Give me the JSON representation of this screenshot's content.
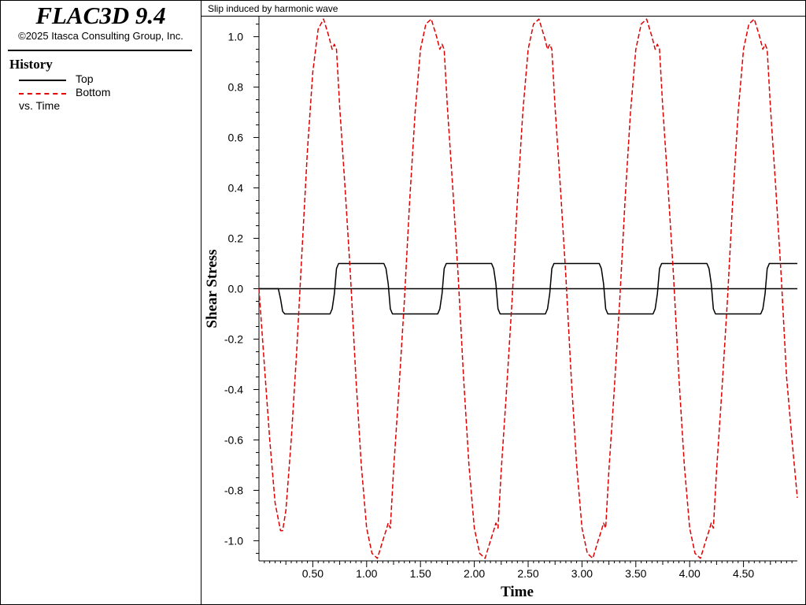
{
  "app": {
    "title": "FLAC3D 9.4",
    "copyright": "©2025 Itasca Consulting Group, Inc."
  },
  "legend": {
    "heading": "History",
    "items": [
      {
        "label": "Top",
        "color": "#000000",
        "style": "solid"
      },
      {
        "label": "Bottom",
        "color": "#e00000",
        "style": "dashed"
      }
    ],
    "vs_label": "vs. Time"
  },
  "chart_data": {
    "type": "line",
    "title": "Slip induced by harmonic wave",
    "xlabel": "Time",
    "ylabel": "Shear Stress",
    "xlim": [
      0.0,
      5.0
    ],
    "ylim": [
      -1.08,
      1.08
    ],
    "x_ticks": [
      0.5,
      1.0,
      1.5,
      2.0,
      2.5,
      3.0,
      3.5,
      4.0,
      4.5
    ],
    "x_tick_labels": [
      "0.50",
      "1.00",
      "1.50",
      "2.00",
      "2.50",
      "3.00",
      "3.50",
      "4.00",
      "4.50"
    ],
    "y_ticks": [
      -1.0,
      -0.8,
      -0.6,
      -0.4,
      -0.2,
      0.0,
      0.2,
      0.4,
      0.6,
      0.8,
      1.0
    ],
    "y_tick_labels": [
      "-1.0",
      "-0.8",
      "-0.6",
      "-0.4",
      "-0.2",
      "0.0",
      "0.2",
      "0.4",
      "0.6",
      "0.8",
      "1.0"
    ],
    "grid": false,
    "series": [
      {
        "name": "Top",
        "color": "#000000",
        "dash": "solid",
        "x": [
          0.0,
          0.18,
          0.2,
          0.22,
          0.24,
          0.66,
          0.68,
          0.7,
          0.72,
          0.74,
          1.16,
          1.18,
          1.2,
          1.22,
          1.24,
          1.66,
          1.68,
          1.7,
          1.72,
          1.74,
          2.16,
          2.18,
          2.2,
          2.22,
          2.24,
          2.66,
          2.68,
          2.7,
          2.72,
          2.74,
          3.16,
          3.18,
          3.2,
          3.22,
          3.24,
          3.66,
          3.68,
          3.7,
          3.72,
          3.74,
          4.16,
          4.18,
          4.2,
          4.22,
          4.24,
          4.66,
          4.68,
          4.7,
          4.72,
          4.74,
          5.0
        ],
        "y": [
          0.0,
          0.0,
          -0.04,
          -0.09,
          -0.1,
          -0.1,
          -0.08,
          -0.02,
          0.08,
          0.1,
          0.1,
          0.08,
          0.02,
          -0.08,
          -0.1,
          -0.1,
          -0.08,
          -0.02,
          0.08,
          0.1,
          0.1,
          0.08,
          0.02,
          -0.08,
          -0.1,
          -0.1,
          -0.08,
          -0.02,
          0.08,
          0.1,
          0.1,
          0.08,
          0.02,
          -0.08,
          -0.1,
          -0.1,
          -0.08,
          -0.02,
          0.08,
          0.1,
          0.1,
          0.08,
          0.02,
          -0.08,
          -0.1,
          -0.1,
          -0.08,
          -0.02,
          0.08,
          0.1,
          0.1
        ]
      },
      {
        "name": "Bottom",
        "color": "#e00000",
        "dash": "dashed",
        "x": [
          0.0,
          0.05,
          0.1,
          0.15,
          0.2,
          0.22,
          0.25,
          0.3,
          0.35,
          0.4,
          0.45,
          0.5,
          0.55,
          0.6,
          0.65,
          0.68,
          0.7,
          0.72,
          0.75,
          0.8,
          0.85,
          0.9,
          0.95,
          1.0,
          1.05,
          1.1,
          1.15,
          1.18,
          1.2,
          1.22,
          1.25,
          1.3,
          1.35,
          1.4,
          1.45,
          1.5,
          1.55,
          1.6,
          1.65,
          1.68,
          1.7,
          1.72,
          1.75,
          1.8,
          1.85,
          1.9,
          1.95,
          2.0,
          2.05,
          2.1,
          2.15,
          2.18,
          2.2,
          2.22,
          2.25,
          2.3,
          2.35,
          2.4,
          2.45,
          2.5,
          2.55,
          2.6,
          2.65,
          2.68,
          2.7,
          2.72,
          2.75,
          2.8,
          2.85,
          2.9,
          2.95,
          3.0,
          3.05,
          3.1,
          3.15,
          3.18,
          3.2,
          3.22,
          3.25,
          3.3,
          3.35,
          3.4,
          3.45,
          3.5,
          3.55,
          3.6,
          3.65,
          3.68,
          3.7,
          3.72,
          3.75,
          3.8,
          3.85,
          3.9,
          3.95,
          4.0,
          4.05,
          4.1,
          4.15,
          4.18,
          4.2,
          4.22,
          4.25,
          4.3,
          4.35,
          4.4,
          4.45,
          4.5,
          4.55,
          4.6,
          4.65,
          4.68,
          4.7,
          4.72,
          4.75,
          4.8,
          4.85,
          4.9,
          4.95,
          5.0
        ],
        "y": [
          0.0,
          -0.3,
          -0.6,
          -0.85,
          -0.96,
          -0.96,
          -0.88,
          -0.6,
          -0.25,
          0.15,
          0.55,
          0.86,
          1.03,
          1.07,
          1.0,
          0.95,
          0.97,
          0.95,
          0.72,
          0.4,
          0.05,
          -0.35,
          -0.7,
          -0.95,
          -1.05,
          -1.07,
          -1.0,
          -0.96,
          -0.93,
          -0.95,
          -0.72,
          -0.4,
          -0.05,
          0.35,
          0.7,
          0.95,
          1.05,
          1.07,
          1.0,
          0.95,
          0.97,
          0.95,
          0.72,
          0.4,
          0.05,
          -0.35,
          -0.7,
          -0.95,
          -1.05,
          -1.07,
          -1.0,
          -0.96,
          -0.93,
          -0.95,
          -0.72,
          -0.4,
          -0.05,
          0.35,
          0.7,
          0.95,
          1.05,
          1.07,
          1.0,
          0.95,
          0.97,
          0.95,
          0.72,
          0.4,
          0.05,
          -0.35,
          -0.7,
          -0.95,
          -1.05,
          -1.07,
          -1.0,
          -0.96,
          -0.93,
          -0.95,
          -0.72,
          -0.4,
          -0.05,
          0.35,
          0.7,
          0.95,
          1.05,
          1.07,
          1.0,
          0.95,
          0.97,
          0.95,
          0.72,
          0.4,
          0.05,
          -0.35,
          -0.7,
          -0.95,
          -1.05,
          -1.07,
          -1.0,
          -0.96,
          -0.93,
          -0.95,
          -0.72,
          -0.4,
          -0.05,
          0.35,
          0.7,
          0.95,
          1.05,
          1.07,
          1.0,
          0.95,
          0.97,
          0.95,
          0.72,
          0.4,
          0.05,
          -0.35,
          -0.6,
          -0.83
        ]
      }
    ]
  }
}
